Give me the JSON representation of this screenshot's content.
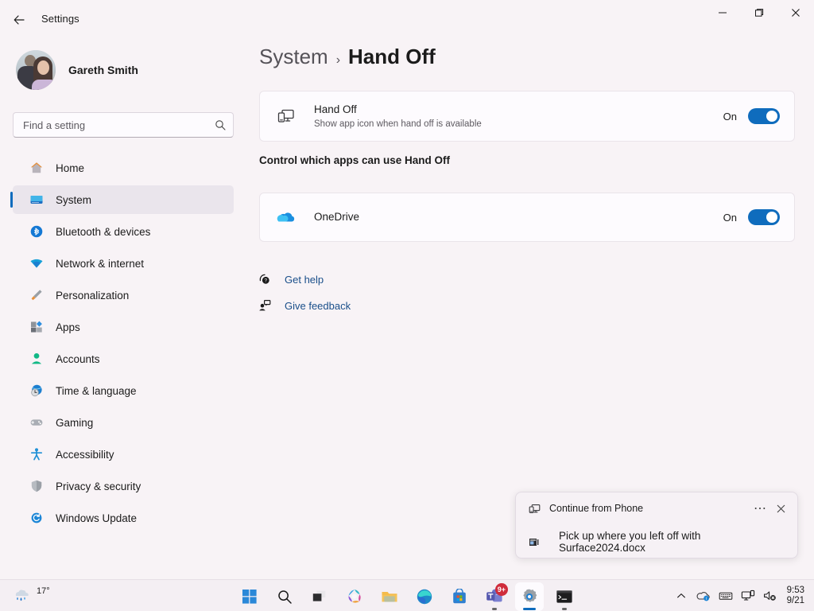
{
  "window": {
    "title": "Settings",
    "back_icon": "back-arrow-icon",
    "minimize_label": "—",
    "maximize_label": "❐",
    "close_label": "✕"
  },
  "sidebar": {
    "account": {
      "name": "Gareth Smith",
      "avatar_icon": "user-avatar-photo"
    },
    "search": {
      "placeholder": "Find a setting",
      "value": "",
      "icon": "search-icon"
    },
    "items": [
      {
        "label": "Home",
        "icon": "home-icon",
        "selected": false
      },
      {
        "label": "System",
        "icon": "system-monitor-icon",
        "selected": true
      },
      {
        "label": "Bluetooth & devices",
        "icon": "bluetooth-icon",
        "selected": false
      },
      {
        "label": "Network & internet",
        "icon": "wifi-icon",
        "selected": false
      },
      {
        "label": "Personalization",
        "icon": "paintbrush-icon",
        "selected": false
      },
      {
        "label": "Apps",
        "icon": "apps-icon",
        "selected": false
      },
      {
        "label": "Accounts",
        "icon": "account-person-icon",
        "selected": false
      },
      {
        "label": "Time & language",
        "icon": "clock-globe-icon",
        "selected": false
      },
      {
        "label": "Gaming",
        "icon": "gamepad-icon",
        "selected": false
      },
      {
        "label": "Accessibility",
        "icon": "accessibility-person-icon",
        "selected": false
      },
      {
        "label": "Privacy & security",
        "icon": "shield-icon",
        "selected": false
      },
      {
        "label": "Windows Update",
        "icon": "update-refresh-icon",
        "selected": false
      }
    ]
  },
  "main": {
    "breadcrumb": {
      "parent": "System",
      "separator": "›",
      "current": "Hand Off"
    },
    "handoff_card": {
      "icon": "handoff-monitor-phone-icon",
      "title": "Hand Off",
      "subtitle": "Show app icon when hand off is available",
      "toggle_label": "On",
      "toggle_state": "on"
    },
    "section_heading": "Control which apps can use Hand Off",
    "app_cards": [
      {
        "icon": "onedrive-cloud-icon",
        "name": "OneDrive",
        "toggle_label": "On",
        "toggle_state": "on"
      }
    ],
    "links": [
      {
        "label": "Get help",
        "icon": "help-question-icon"
      },
      {
        "label": "Give feedback",
        "icon": "feedback-person-icon"
      }
    ]
  },
  "toast": {
    "app_icon": "handoff-monitor-phone-icon",
    "app_name": "Continue from Phone",
    "more_label": "⋯",
    "close_label": "✕",
    "file_icon": "document-file-icon",
    "message": "Pick up where you left off with Surface2024.docx"
  },
  "taskbar": {
    "weather": {
      "temperature": "17°",
      "icon": "rain-showers-icon"
    },
    "items": [
      {
        "name": "start",
        "icon": "windows-start-icon",
        "active": false,
        "badge": ""
      },
      {
        "name": "search",
        "icon": "search-icon",
        "active": false,
        "badge": ""
      },
      {
        "name": "task-view",
        "icon": "task-view-icon",
        "active": false,
        "badge": ""
      },
      {
        "name": "copilot",
        "icon": "copilot-icon",
        "active": false,
        "badge": ""
      },
      {
        "name": "file-explorer",
        "icon": "folder-icon",
        "active": false,
        "badge": ""
      },
      {
        "name": "edge",
        "icon": "edge-browser-icon",
        "active": false,
        "badge": ""
      },
      {
        "name": "microsoft-store",
        "icon": "store-bag-icon",
        "active": false,
        "badge": ""
      },
      {
        "name": "teams",
        "icon": "teams-icon",
        "active": false,
        "badge": "9+"
      },
      {
        "name": "settings",
        "icon": "gear-icon",
        "active": true,
        "badge": ""
      },
      {
        "name": "terminal",
        "icon": "terminal-icon",
        "active": false,
        "badge": ""
      }
    ],
    "tray": {
      "chevron": "chevron-up-icon",
      "onedrive": "onedrive-tray-icon",
      "keyboard": "keyboard-ime-icon",
      "handoff": "handoff-tray-icon",
      "volume": "volume-muted-icon",
      "time": "9:53",
      "date": "9/21"
    }
  },
  "colors": {
    "accent": "#0f6cbd",
    "link": "#1a4f8a",
    "background": "#f8f3f6",
    "card": "#fdfbfe",
    "badge": "#cf2c3b"
  }
}
